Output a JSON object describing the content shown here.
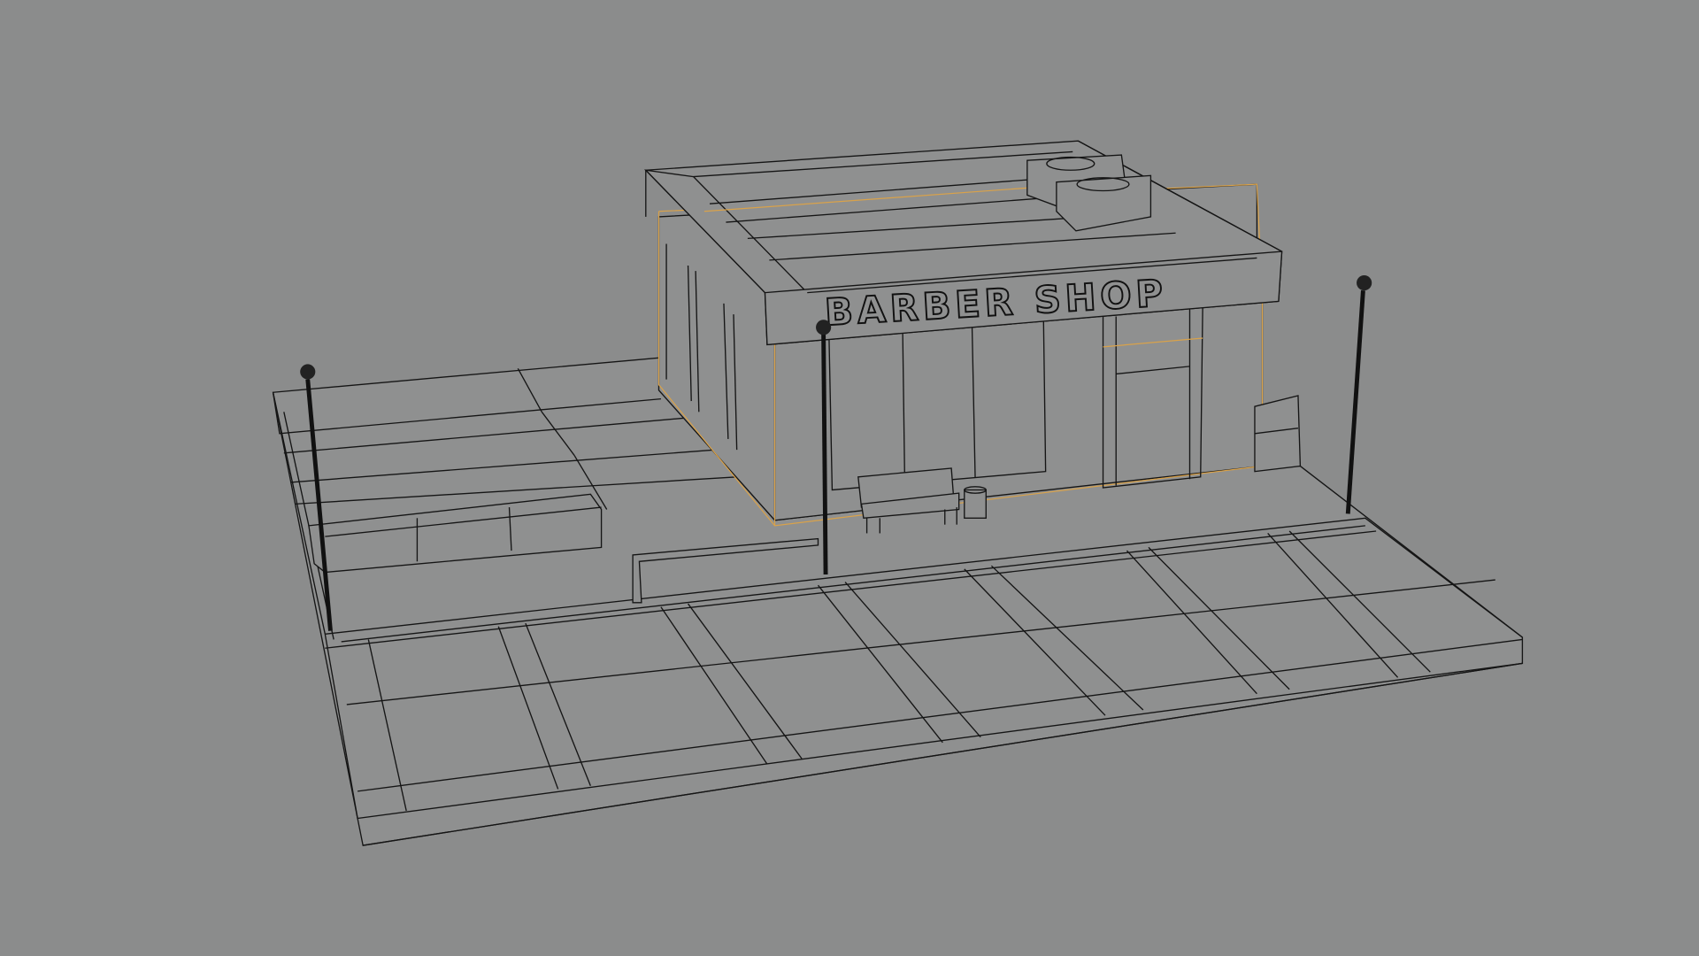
{
  "scene": {
    "shop_sign": "BARBER SHOP",
    "colors": {
      "background": "#8b8c8c",
      "wire": "#151515",
      "selection": "#d9a24a"
    }
  }
}
